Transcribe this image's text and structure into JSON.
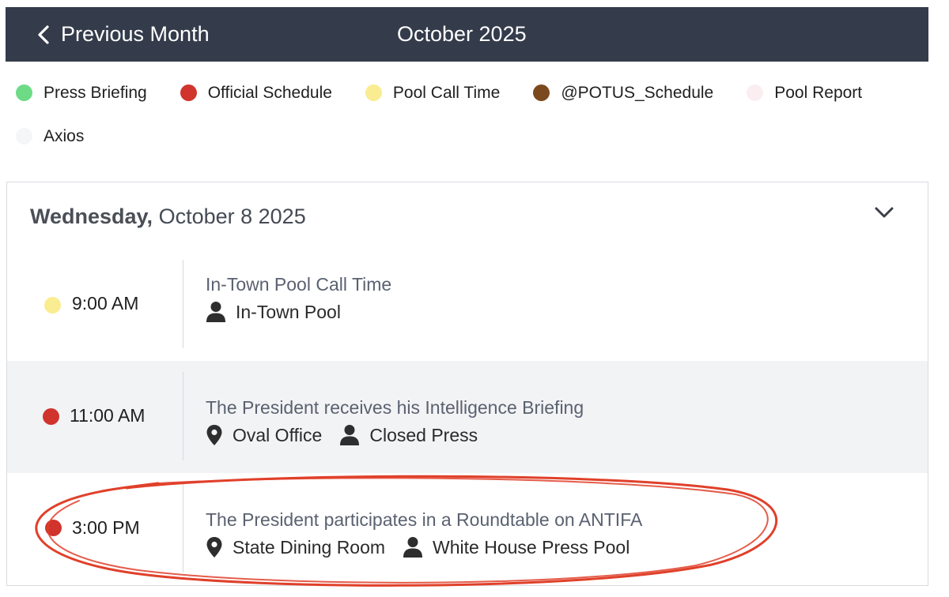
{
  "header": {
    "prev_label": "Previous Month",
    "month_title": "October 2025"
  },
  "legend": [
    {
      "label": "Press Briefing",
      "color": "#6ddb85"
    },
    {
      "label": "Official Schedule",
      "color": "#d0342c"
    },
    {
      "label": "Pool Call Time",
      "color": "#faec91"
    },
    {
      "label": "@POTUS_Schedule",
      "color": "#7a4a1e"
    },
    {
      "label": "Pool Report",
      "color": "#fbeef0"
    },
    {
      "label": "Axios",
      "color": "#f5f6f8"
    }
  ],
  "day": {
    "weekday": "Wednesday,",
    "date": "October 8 2025",
    "events": [
      {
        "time": "9:00 AM",
        "dot_color": "#faec91",
        "title": "In-Town Pool Call Time",
        "location": "",
        "press": "In-Town Pool"
      },
      {
        "time": "11:00 AM",
        "dot_color": "#d0342c",
        "title": "The President receives his Intelligence Briefing",
        "location": "Oval Office",
        "press": "Closed Press"
      },
      {
        "time": "3:00 PM",
        "dot_color": "#d0342c",
        "title": "The President participates in a Roundtable on ANTIFA",
        "location": "State Dining Room",
        "press": "White House Press Pool"
      }
    ]
  },
  "annotation": {
    "color": "#e0402a"
  },
  "icons": {
    "back": "chevron-left-icon",
    "collapse": "chevron-down-icon",
    "location": "map-pin-icon",
    "press": "person-icon"
  }
}
